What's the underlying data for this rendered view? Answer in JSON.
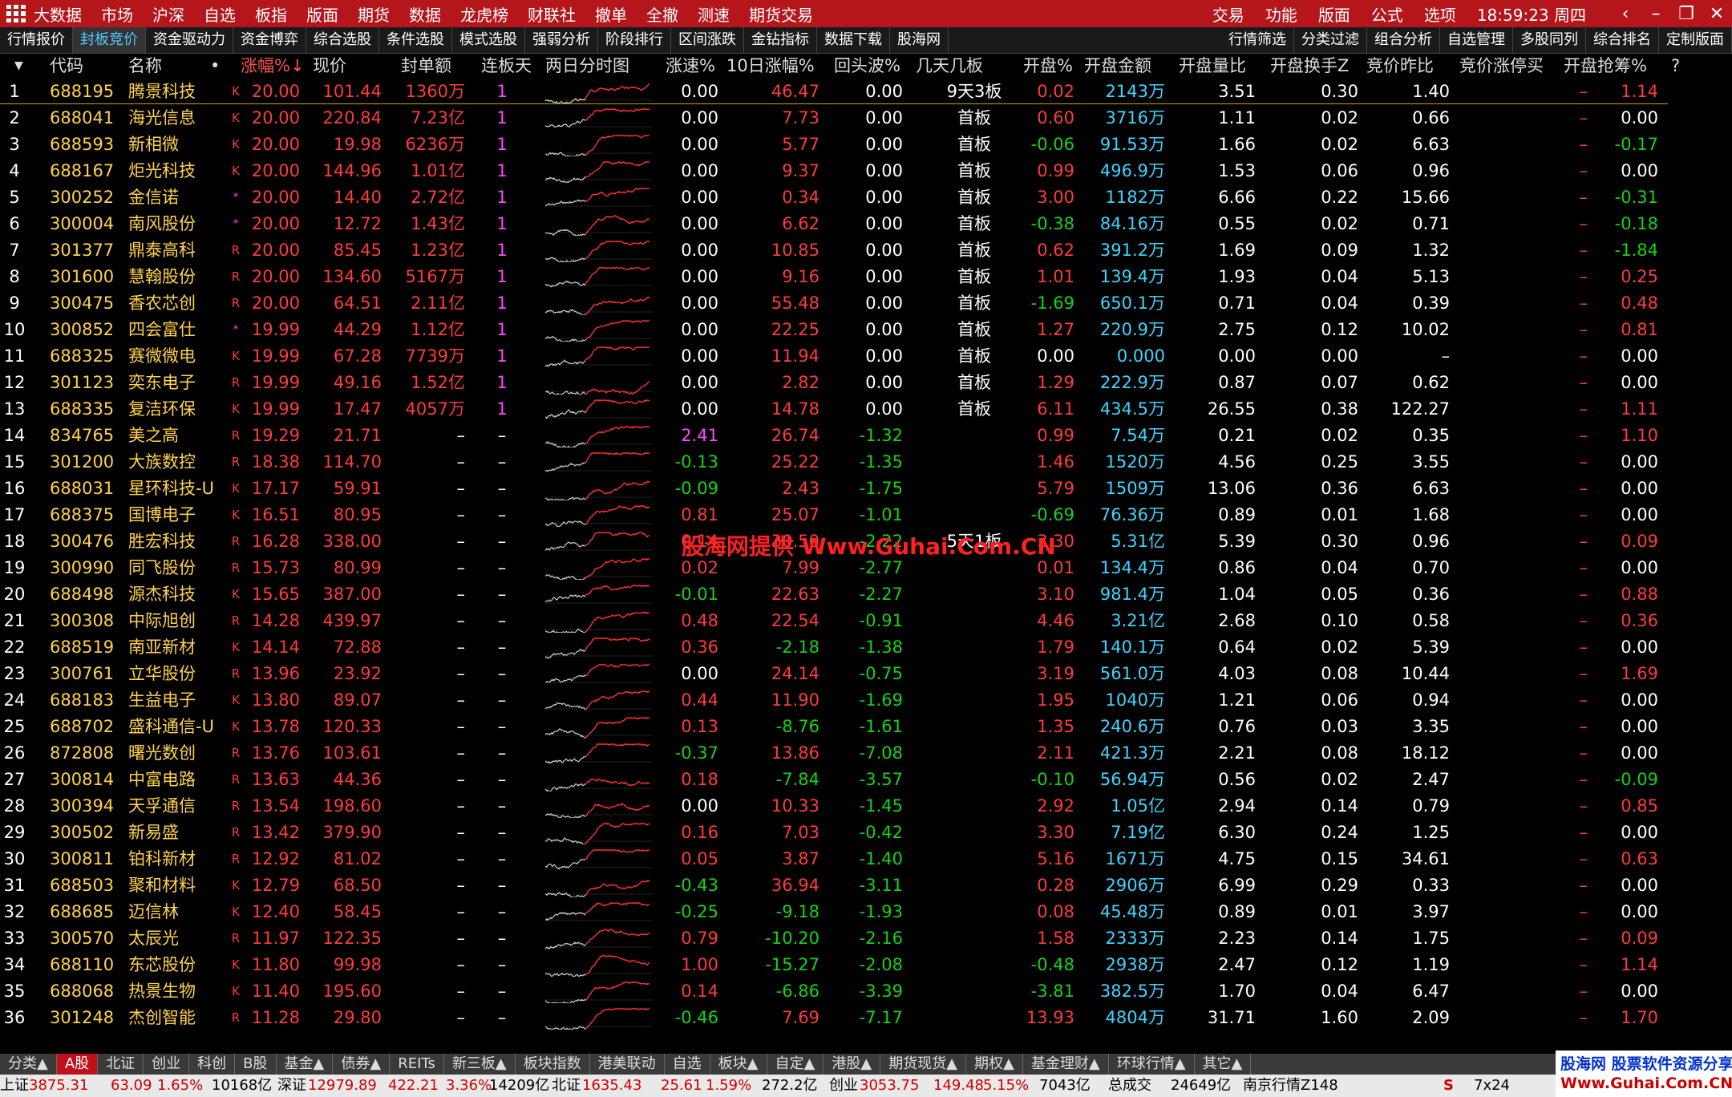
{
  "title_menu": [
    "大数据",
    "市场",
    "沪深",
    "自选",
    "板指",
    "版面",
    "期货",
    "数据",
    "龙虎榜",
    "财联社",
    "撤单",
    "全撤",
    "测速",
    "期货交易"
  ],
  "title_right": [
    "交易",
    "功能",
    "版面",
    "公式",
    "选项"
  ],
  "clock": "18:59:23 周四",
  "func_tabs": [
    "行情报价",
    "封板竞价",
    "资金驱动力",
    "资金博弈",
    "综合选股",
    "条件选股",
    "模式选股",
    "强弱分析",
    "阶段排行",
    "区间涨跌",
    "金钻指标",
    "数据下载",
    "股海网"
  ],
  "func_tabs_active": 1,
  "func_tabs_right": [
    "行情筛选",
    "分类过滤",
    "组合分析",
    "自选管理",
    "多股同列",
    "综合排名",
    "定制版面"
  ],
  "headers": [
    "代码",
    "名称",
    "•",
    "涨幅%↓",
    "现价",
    "封单额",
    "连板天",
    "两日分时图",
    "涨速%",
    "10日涨幅%",
    "回头波%",
    "几天几板",
    "开盘%",
    "开盘金额",
    "开盘量比",
    "开盘换手Z",
    "竞价昨比",
    "竞价涨停买",
    "开盘抢筹%",
    "?"
  ],
  "rows": [
    {
      "i": "1",
      "code": "688195",
      "name": "腾景科技",
      "tag": "K",
      "chg": "20.00",
      "price": "101.44",
      "seal": "1360万",
      "lb": "1",
      "spd": "0.00",
      "d10": "46.47",
      "hb": "0.00",
      "jt": "9天3板",
      "op": "0.02",
      "oa": "2143万",
      "ovr": "3.51",
      "oh": "0.30",
      "jb": "1.40",
      "jz": "–",
      "qc": "1.14"
    },
    {
      "i": "2",
      "code": "688041",
      "name": "海光信息",
      "tag": "K",
      "chg": "20.00",
      "price": "220.84",
      "seal": "7.23亿",
      "lb": "1",
      "spd": "0.00",
      "d10": "7.73",
      "hb": "0.00",
      "jt": "首板",
      "op": "0.60",
      "oa": "3716万",
      "ovr": "1.11",
      "oh": "0.02",
      "jb": "0.66",
      "jz": "–",
      "qc": "0.00"
    },
    {
      "i": "3",
      "code": "688593",
      "name": "新相微",
      "tag": "K",
      "chg": "20.00",
      "price": "19.98",
      "seal": "6236万",
      "lb": "1",
      "spd": "0.00",
      "d10": "5.77",
      "hb": "0.00",
      "jt": "首板",
      "op": "-0.06",
      "oa": "91.53万",
      "ovr": "1.66",
      "oh": "0.02",
      "jb": "6.63",
      "jz": "–",
      "qc": "-0.17"
    },
    {
      "i": "4",
      "code": "688167",
      "name": "炬光科技",
      "tag": "K",
      "chg": "20.00",
      "price": "144.96",
      "seal": "1.01亿",
      "lb": "1",
      "spd": "0.00",
      "d10": "9.37",
      "hb": "0.00",
      "jt": "首板",
      "op": "0.99",
      "oa": "496.9万",
      "ovr": "1.53",
      "oh": "0.06",
      "jb": "0.96",
      "jz": "–",
      "qc": "0.00"
    },
    {
      "i": "5",
      "code": "300252",
      "name": "金信诺",
      "tag": "*",
      "chg": "20.00",
      "price": "14.40",
      "seal": "2.72亿",
      "lb": "1",
      "spd": "0.00",
      "d10": "0.34",
      "hb": "0.00",
      "jt": "首板",
      "op": "3.00",
      "oa": "1182万",
      "ovr": "6.66",
      "oh": "0.22",
      "jb": "15.66",
      "jz": "–",
      "qc": "-0.31"
    },
    {
      "i": "6",
      "code": "300004",
      "name": "南风股份",
      "tag": "*",
      "chg": "20.00",
      "price": "12.72",
      "seal": "1.43亿",
      "lb": "1",
      "spd": "0.00",
      "d10": "6.62",
      "hb": "0.00",
      "jt": "首板",
      "op": "-0.38",
      "oa": "84.16万",
      "ovr": "0.55",
      "oh": "0.02",
      "jb": "0.71",
      "jz": "–",
      "qc": "-0.18"
    },
    {
      "i": "7",
      "code": "301377",
      "name": "鼎泰高科",
      "tag": "R",
      "chg": "20.00",
      "price": "85.45",
      "seal": "1.23亿",
      "lb": "1",
      "spd": "0.00",
      "d10": "10.85",
      "hb": "0.00",
      "jt": "首板",
      "op": "0.62",
      "oa": "391.2万",
      "ovr": "1.69",
      "oh": "0.09",
      "jb": "1.32",
      "jz": "–",
      "qc": "-1.84"
    },
    {
      "i": "8",
      "code": "301600",
      "name": "慧翰股份",
      "tag": "R",
      "chg": "20.00",
      "price": "134.60",
      "seal": "5167万",
      "lb": "1",
      "spd": "0.00",
      "d10": "9.16",
      "hb": "0.00",
      "jt": "首板",
      "op": "1.01",
      "oa": "139.4万",
      "ovr": "1.93",
      "oh": "0.04",
      "jb": "5.13",
      "jz": "–",
      "qc": "0.25"
    },
    {
      "i": "9",
      "code": "300475",
      "name": "香农芯创",
      "tag": "R",
      "chg": "20.00",
      "price": "64.51",
      "seal": "2.11亿",
      "lb": "1",
      "spd": "0.00",
      "d10": "55.48",
      "hb": "0.00",
      "jt": "首板",
      "op": "-1.69",
      "oa": "650.1万",
      "ovr": "0.71",
      "oh": "0.04",
      "jb": "0.39",
      "jz": "–",
      "qc": "0.48"
    },
    {
      "i": "10",
      "code": "300852",
      "name": "四会富仕",
      "tag": "*",
      "chg": "19.99",
      "price": "44.29",
      "seal": "1.12亿",
      "lb": "1",
      "spd": "0.00",
      "d10": "22.25",
      "hb": "0.00",
      "jt": "首板",
      "op": "1.27",
      "oa": "220.9万",
      "ovr": "2.75",
      "oh": "0.12",
      "jb": "10.02",
      "jz": "–",
      "qc": "0.81"
    },
    {
      "i": "11",
      "code": "688325",
      "name": "赛微微电",
      "tag": "K",
      "chg": "19.99",
      "price": "67.28",
      "seal": "7739万",
      "lb": "1",
      "spd": "0.00",
      "d10": "11.94",
      "hb": "0.00",
      "jt": "首板",
      "op": "0.00",
      "oa": "0.000",
      "ovr": "0.00",
      "oh": "0.00",
      "jb": "–",
      "jz": "–",
      "qc": "0.00"
    },
    {
      "i": "12",
      "code": "301123",
      "name": "奕东电子",
      "tag": "R",
      "chg": "19.99",
      "price": "49.16",
      "seal": "1.52亿",
      "lb": "1",
      "spd": "0.00",
      "d10": "2.82",
      "hb": "0.00",
      "jt": "首板",
      "op": "1.29",
      "oa": "222.9万",
      "ovr": "0.87",
      "oh": "0.07",
      "jb": "0.62",
      "jz": "–",
      "qc": "0.00"
    },
    {
      "i": "13",
      "code": "688335",
      "name": "复洁环保",
      "tag": "K",
      "chg": "19.99",
      "price": "17.47",
      "seal": "4057万",
      "lb": "1",
      "spd": "0.00",
      "d10": "14.78",
      "hb": "0.00",
      "jt": "首板",
      "op": "6.11",
      "oa": "434.5万",
      "ovr": "26.55",
      "oh": "0.38",
      "jb": "122.27",
      "jz": "–",
      "qc": "1.11"
    },
    {
      "i": "14",
      "code": "834765",
      "name": "美之高",
      "tag": "R",
      "chg": "19.29",
      "price": "21.71",
      "seal": "–",
      "lb": "–",
      "spd": "2.41",
      "d10": "26.74",
      "hb": "-1.32",
      "jt": "",
      "op": "0.99",
      "oa": "7.54万",
      "ovr": "0.21",
      "oh": "0.02",
      "jb": "0.35",
      "jz": "–",
      "qc": "1.10"
    },
    {
      "i": "15",
      "code": "301200",
      "name": "大族数控",
      "tag": "R",
      "chg": "18.38",
      "price": "114.70",
      "seal": "–",
      "lb": "–",
      "spd": "-0.13",
      "d10": "25.22",
      "hb": "-1.35",
      "jt": "",
      "op": "1.46",
      "oa": "1520万",
      "ovr": "4.56",
      "oh": "0.25",
      "jb": "3.55",
      "jz": "–",
      "qc": "0.00"
    },
    {
      "i": "16",
      "code": "688031",
      "name": "星环科技-U",
      "tag": "K",
      "chg": "17.17",
      "price": "59.91",
      "seal": "–",
      "lb": "–",
      "spd": "-0.09",
      "d10": "2.43",
      "hb": "-1.75",
      "jt": "",
      "op": "5.79",
      "oa": "1509万",
      "ovr": "13.06",
      "oh": "0.36",
      "jb": "6.63",
      "jz": "–",
      "qc": "0.00"
    },
    {
      "i": "17",
      "code": "688375",
      "name": "国博电子",
      "tag": "K",
      "chg": "16.51",
      "price": "80.95",
      "seal": "–",
      "lb": "–",
      "spd": "0.81",
      "d10": "25.07",
      "hb": "-1.01",
      "jt": "",
      "op": "-0.69",
      "oa": "76.36万",
      "ovr": "0.89",
      "oh": "0.01",
      "jb": "1.68",
      "jz": "–",
      "qc": "0.00"
    },
    {
      "i": "18",
      "code": "300476",
      "name": "胜宏科技",
      "tag": "R",
      "chg": "16.28",
      "price": "338.00",
      "seal": "–",
      "lb": "–",
      "spd": "0.14",
      "d10": "30.50",
      "hb": "-2.22",
      "jt": "5天1板",
      "op": "3.30",
      "oa": "5.31亿",
      "ovr": "5.39",
      "oh": "0.30",
      "jb": "0.96",
      "jz": "–",
      "qc": "0.09"
    },
    {
      "i": "19",
      "code": "300990",
      "name": "同飞股份",
      "tag": "R",
      "chg": "15.73",
      "price": "80.99",
      "seal": "–",
      "lb": "–",
      "spd": "0.02",
      "d10": "7.99",
      "hb": "-2.77",
      "jt": "",
      "op": "0.01",
      "oa": "134.4万",
      "ovr": "0.86",
      "oh": "0.04",
      "jb": "0.70",
      "jz": "–",
      "qc": "0.00"
    },
    {
      "i": "20",
      "code": "688498",
      "name": "源杰科技",
      "tag": "K",
      "chg": "15.65",
      "price": "387.00",
      "seal": "–",
      "lb": "–",
      "spd": "-0.01",
      "d10": "22.63",
      "hb": "-2.27",
      "jt": "",
      "op": "3.10",
      "oa": "981.4万",
      "ovr": "1.04",
      "oh": "0.05",
      "jb": "0.36",
      "jz": "–",
      "qc": "0.88"
    },
    {
      "i": "21",
      "code": "300308",
      "name": "中际旭创",
      "tag": "R",
      "chg": "14.28",
      "price": "439.97",
      "seal": "–",
      "lb": "–",
      "spd": "0.48",
      "d10": "22.54",
      "hb": "-0.91",
      "jt": "",
      "op": "4.46",
      "oa": "3.21亿",
      "ovr": "2.68",
      "oh": "0.10",
      "jb": "0.58",
      "jz": "–",
      "qc": "0.36"
    },
    {
      "i": "22",
      "code": "688519",
      "name": "南亚新材",
      "tag": "K",
      "chg": "14.14",
      "price": "72.88",
      "seal": "–",
      "lb": "–",
      "spd": "0.36",
      "d10": "-2.18",
      "hb": "-1.38",
      "jt": "",
      "op": "1.79",
      "oa": "140.1万",
      "ovr": "0.64",
      "oh": "0.02",
      "jb": "5.39",
      "jz": "–",
      "qc": "0.00"
    },
    {
      "i": "23",
      "code": "300761",
      "name": "立华股份",
      "tag": "R",
      "chg": "13.96",
      "price": "23.92",
      "seal": "–",
      "lb": "–",
      "spd": "0.00",
      "d10": "24.14",
      "hb": "-0.75",
      "jt": "",
      "op": "3.19",
      "oa": "561.0万",
      "ovr": "4.03",
      "oh": "0.08",
      "jb": "10.44",
      "jz": "–",
      "qc": "1.69"
    },
    {
      "i": "24",
      "code": "688183",
      "name": "生益电子",
      "tag": "K",
      "chg": "13.80",
      "price": "89.07",
      "seal": "–",
      "lb": "–",
      "spd": "0.44",
      "d10": "11.90",
      "hb": "-1.69",
      "jt": "",
      "op": "1.95",
      "oa": "1040万",
      "ovr": "1.21",
      "oh": "0.06",
      "jb": "0.94",
      "jz": "–",
      "qc": "0.00"
    },
    {
      "i": "25",
      "code": "688702",
      "name": "盛科通信-U",
      "tag": "K",
      "chg": "13.78",
      "price": "120.33",
      "seal": "–",
      "lb": "–",
      "spd": "0.13",
      "d10": "-8.76",
      "hb": "-1.61",
      "jt": "",
      "op": "1.35",
      "oa": "240.6万",
      "ovr": "0.76",
      "oh": "0.03",
      "jb": "3.35",
      "jz": "–",
      "qc": "0.00"
    },
    {
      "i": "26",
      "code": "872808",
      "name": "曙光数创",
      "tag": "R",
      "chg": "13.76",
      "price": "103.61",
      "seal": "–",
      "lb": "–",
      "spd": "-0.37",
      "d10": "13.86",
      "hb": "-7.08",
      "jt": "",
      "op": "2.11",
      "oa": "421.3万",
      "ovr": "2.21",
      "oh": "0.08",
      "jb": "18.12",
      "jz": "–",
      "qc": "0.00"
    },
    {
      "i": "27",
      "code": "300814",
      "name": "中富电路",
      "tag": "R",
      "chg": "13.63",
      "price": "44.36",
      "seal": "–",
      "lb": "–",
      "spd": "0.18",
      "d10": "-7.84",
      "hb": "-3.57",
      "jt": "",
      "op": "-0.10",
      "oa": "56.94万",
      "ovr": "0.56",
      "oh": "0.02",
      "jb": "2.47",
      "jz": "–",
      "qc": "-0.09"
    },
    {
      "i": "28",
      "code": "300394",
      "name": "天孚通信",
      "tag": "R",
      "chg": "13.54",
      "price": "198.60",
      "seal": "–",
      "lb": "–",
      "spd": "0.00",
      "d10": "10.33",
      "hb": "-1.45",
      "jt": "",
      "op": "2.92",
      "oa": "1.05亿",
      "ovr": "2.94",
      "oh": "0.14",
      "jb": "0.79",
      "jz": "–",
      "qc": "0.85"
    },
    {
      "i": "29",
      "code": "300502",
      "name": "新易盛",
      "tag": "R",
      "chg": "13.42",
      "price": "379.90",
      "seal": "–",
      "lb": "–",
      "spd": "0.16",
      "d10": "7.03",
      "hb": "-0.42",
      "jt": "",
      "op": "3.30",
      "oa": "7.19亿",
      "ovr": "6.30",
      "oh": "0.24",
      "jb": "1.25",
      "jz": "–",
      "qc": "0.00"
    },
    {
      "i": "30",
      "code": "300811",
      "name": "铂科新材",
      "tag": "R",
      "chg": "12.92",
      "price": "81.02",
      "seal": "–",
      "lb": "–",
      "spd": "0.05",
      "d10": "3.87",
      "hb": "-1.40",
      "jt": "",
      "op": "5.16",
      "oa": "1671万",
      "ovr": "4.75",
      "oh": "0.15",
      "jb": "34.61",
      "jz": "–",
      "qc": "0.63"
    },
    {
      "i": "31",
      "code": "688503",
      "name": "聚和材料",
      "tag": "K",
      "chg": "12.79",
      "price": "68.50",
      "seal": "–",
      "lb": "–",
      "spd": "-0.43",
      "d10": "36.94",
      "hb": "-3.11",
      "jt": "",
      "op": "0.28",
      "oa": "2906万",
      "ovr": "6.99",
      "oh": "0.29",
      "jb": "0.33",
      "jz": "–",
      "qc": "0.00"
    },
    {
      "i": "32",
      "code": "688685",
      "name": "迈信林",
      "tag": "K",
      "chg": "12.40",
      "price": "58.45",
      "seal": "–",
      "lb": "–",
      "spd": "-0.25",
      "d10": "-9.18",
      "hb": "-1.93",
      "jt": "",
      "op": "0.08",
      "oa": "45.48万",
      "ovr": "0.89",
      "oh": "0.01",
      "jb": "3.97",
      "jz": "–",
      "qc": "0.00"
    },
    {
      "i": "33",
      "code": "300570",
      "name": "太辰光",
      "tag": "R",
      "chg": "11.97",
      "price": "122.35",
      "seal": "–",
      "lb": "–",
      "spd": "0.79",
      "d10": "-10.20",
      "hb": "-2.16",
      "jt": "",
      "op": "1.58",
      "oa": "2333万",
      "ovr": "2.23",
      "oh": "0.14",
      "jb": "1.75",
      "jz": "–",
      "qc": "0.09"
    },
    {
      "i": "34",
      "code": "688110",
      "name": "东芯股份",
      "tag": "K",
      "chg": "11.80",
      "price": "99.98",
      "seal": "–",
      "lb": "–",
      "spd": "1.00",
      "d10": "-15.27",
      "hb": "-2.08",
      "jt": "",
      "op": "-0.48",
      "oa": "2938万",
      "ovr": "2.47",
      "oh": "0.12",
      "jb": "1.19",
      "jz": "–",
      "qc": "1.14"
    },
    {
      "i": "35",
      "code": "688068",
      "name": "热景生物",
      "tag": "K",
      "chg": "11.40",
      "price": "195.60",
      "seal": "–",
      "lb": "–",
      "spd": "0.14",
      "d10": "-6.86",
      "hb": "-3.39",
      "jt": "",
      "op": "-3.81",
      "oa": "382.5万",
      "ovr": "1.70",
      "oh": "0.04",
      "jb": "6.47",
      "jz": "–",
      "qc": "0.00"
    },
    {
      "i": "36",
      "code": "301248",
      "name": "杰创智能",
      "tag": "R",
      "chg": "11.28",
      "price": "29.80",
      "seal": "–",
      "lb": "–",
      "spd": "-0.46",
      "d10": "7.69",
      "hb": "-7.17",
      "jt": "",
      "op": "13.93",
      "oa": "4804万",
      "ovr": "31.71",
      "oh": "1.60",
      "jb": "2.09",
      "jz": "–",
      "qc": "1.70"
    }
  ],
  "watermark": "股海网提供 Www.Guhai.Com.CN",
  "market_tabs": [
    "分类▲",
    "A股",
    "北证",
    "创业",
    "科创",
    "B股",
    "基金▲",
    "债券▲",
    "REITs",
    "新三板▲",
    "板块指数",
    "港美联动",
    "自选",
    "板块▲",
    "自定▲",
    "港股▲",
    "期货现货▲",
    "期权▲",
    "基金理财▲",
    "环球行情▲",
    "其它▲"
  ],
  "market_tabs_active": 1,
  "status": {
    "sh_label": "上证",
    "sh_val": "3875.31",
    "sh_chg": "63.09",
    "sh_pct": "1.65%",
    "sh_amt": "10168亿",
    "sz_label": "深证",
    "sz_val": "12979.89",
    "sz_chg": "422.21",
    "sz_pct": "3.36%",
    "sz_amt": "14209亿",
    "bz_label": "北证",
    "bz_val": "1635.43",
    "bz_chg": "25.61",
    "bz_pct": "1.59%",
    "bz_amt": "272.2亿",
    "cy_label": "创业",
    "cy_val": "3053.75",
    "cy_chg": "149.48",
    "cy_pct": "5.15%",
    "cy_amt": "7043亿",
    "total_label": "总成交",
    "total_val": "24649亿",
    "server": "南京行情Z148",
    "layout": "7x24"
  },
  "logo": {
    "line1": "股海网 股票软件资源分享",
    "line2": "Www.Guhai.Com.CN"
  }
}
